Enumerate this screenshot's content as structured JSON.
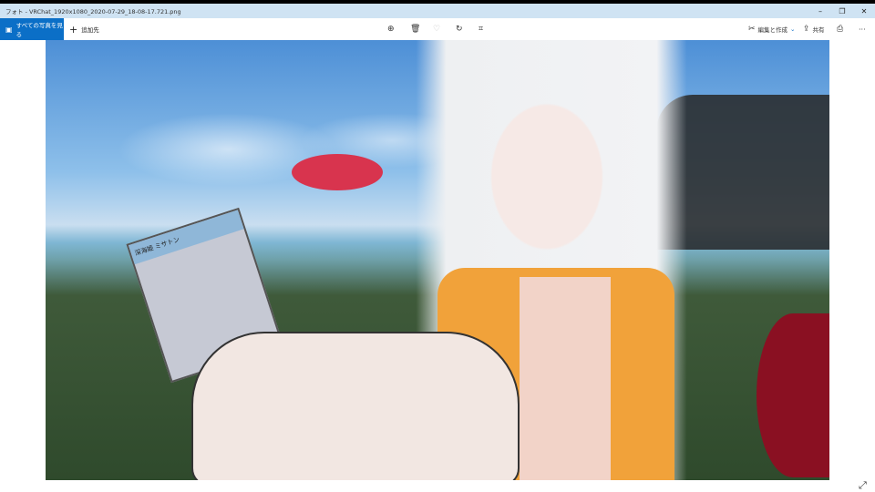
{
  "window": {
    "title": "フォト - VRChat_1920x1080_2020-07-29_18-08-17.721.png",
    "minimize": "–",
    "restore": "❐",
    "close": "✕"
  },
  "toolbar": {
    "all_photos": "すべての写真を見る",
    "add_to": "追加先",
    "edit_create": "編集と作成",
    "share": "共有",
    "more": "···",
    "icons": [
      "zoom-icon",
      "delete-icon",
      "favorite-icon",
      "rotate-icon",
      "crop-icon",
      "print-icon"
    ]
  },
  "photo": {
    "card_name": "深海姫 ミサトン"
  },
  "colors": {
    "accent": "#0b6fc7",
    "titlebar": "#cfe3f3"
  }
}
